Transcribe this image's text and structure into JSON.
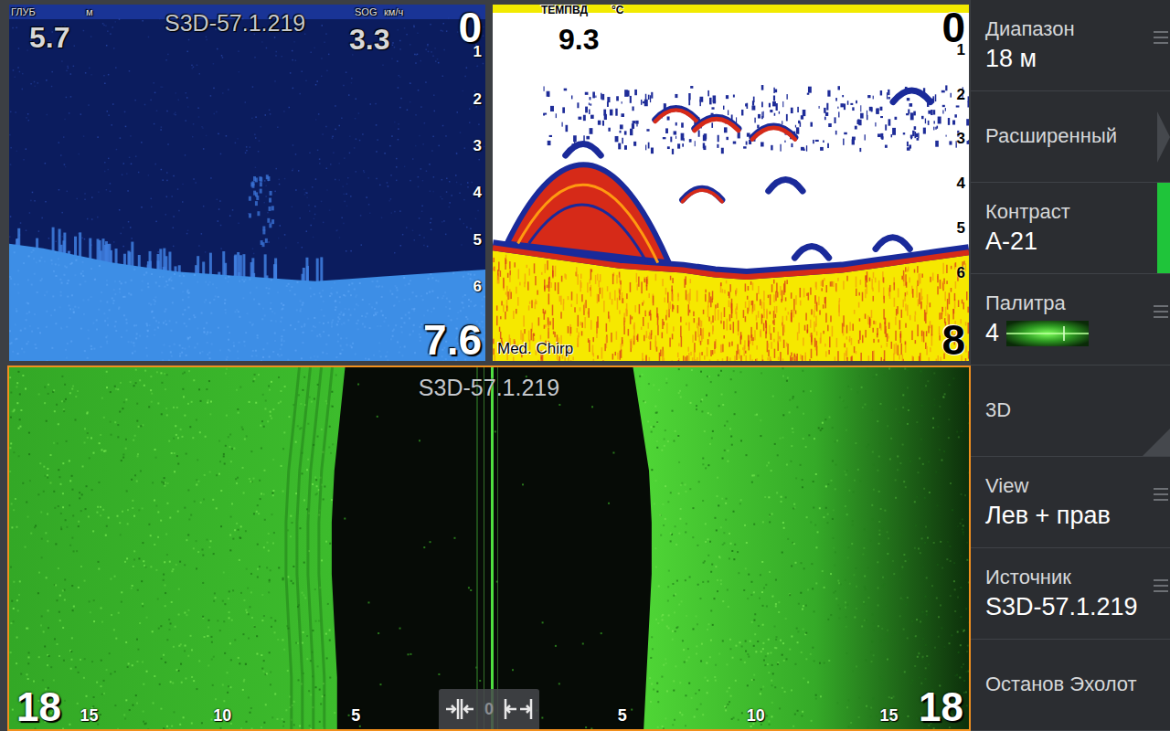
{
  "downscan": {
    "depth_label": "ГЛУБ",
    "depth_unit": "м",
    "depth": "5.7",
    "source": "S3D-57.1.219",
    "sog_label": "SOG",
    "sog_unit": "км/ч",
    "sog": "3.3",
    "range_top": "0",
    "range_bottom": "7.6",
    "ticks": [
      "1",
      "2",
      "3",
      "4",
      "5",
      "6"
    ],
    "bottom_depths": [
      5.1,
      5.2,
      5.35,
      5.5,
      5.6,
      5.7,
      5.75,
      5.8,
      5.85,
      5.9,
      5.85,
      5.8,
      5.75,
      5.7,
      5.65
    ]
  },
  "sonar": {
    "temp_label": "ТЕМПВД",
    "temp_unit": "°C",
    "temp": "9.3",
    "range_top": "0",
    "range_bottom": "8",
    "ticks": [
      "1",
      "2",
      "3",
      "4",
      "5",
      "6"
    ],
    "mode": "Med. Chirp",
    "bottom_depths": [
      5.4,
      5.5,
      5.6,
      5.7,
      5.8,
      5.85,
      5.9,
      6.0,
      6.05,
      6.0,
      5.95,
      5.9,
      5.8,
      5.7,
      5.6,
      5.5
    ],
    "structure": {
      "x": 0.2,
      "width": 0.34,
      "top_depth": 3.6
    },
    "fish": [
      {
        "x": 0.19,
        "depth": 3.2,
        "strength": 0.2
      },
      {
        "x": 0.385,
        "depth": 2.4,
        "strength": 0.8
      },
      {
        "x": 0.47,
        "depth": 2.6,
        "strength": 1
      },
      {
        "x": 0.59,
        "depth": 2.8,
        "strength": 0.9
      },
      {
        "x": 0.88,
        "depth": 2.0,
        "strength": 0.4
      },
      {
        "x": 0.44,
        "depth": 4.2,
        "strength": 0.6
      },
      {
        "x": 0.615,
        "depth": 4.0,
        "strength": 0.1
      },
      {
        "x": 0.67,
        "depth": 5.5,
        "strength": 0.1
      },
      {
        "x": 0.84,
        "depth": 5.3,
        "strength": 0.1
      }
    ]
  },
  "sidescan": {
    "source": "S3D-57.1.219",
    "range_left": "18",
    "range_right": "18",
    "center": "0",
    "ticks": [
      {
        "label": "15",
        "side": "left"
      },
      {
        "label": "10",
        "side": "left"
      },
      {
        "label": "5",
        "side": "left"
      },
      {
        "label": "5",
        "side": "right"
      },
      {
        "label": "10",
        "side": "right"
      },
      {
        "label": "15",
        "side": "right"
      }
    ],
    "water_edge_left_m": [
      5.4,
      5.6,
      5.8,
      5.9,
      5.9,
      5.8,
      5.7,
      5.7
    ],
    "water_edge_right_m": [
      5.4,
      5.7,
      6.0,
      6.1,
      6.1,
      6.0,
      5.9,
      5.8
    ]
  },
  "menu": [
    {
      "label": "Диапазон",
      "value": "18 м",
      "kind": "value",
      "options": true,
      "selected": false
    },
    {
      "label": "Расширенный",
      "kind": "submenu",
      "options": false,
      "selected": false
    },
    {
      "label": "Контраст",
      "value": "A-21",
      "kind": "value",
      "options": false,
      "selected": true
    },
    {
      "label": "Палитра",
      "value": "4",
      "kind": "palette",
      "options": true,
      "selected": false
    },
    {
      "label": "3D",
      "kind": "toggle",
      "options": false,
      "selected": false
    },
    {
      "label": "View",
      "value": "Лев + прав",
      "kind": "value",
      "options": true,
      "selected": false
    },
    {
      "label": "Источник",
      "value": "S3D-57.1.219",
      "kind": "value",
      "options": true,
      "selected": false
    },
    {
      "label": "Останов Эхолот",
      "kind": "action",
      "options": false,
      "selected": false
    }
  ]
}
